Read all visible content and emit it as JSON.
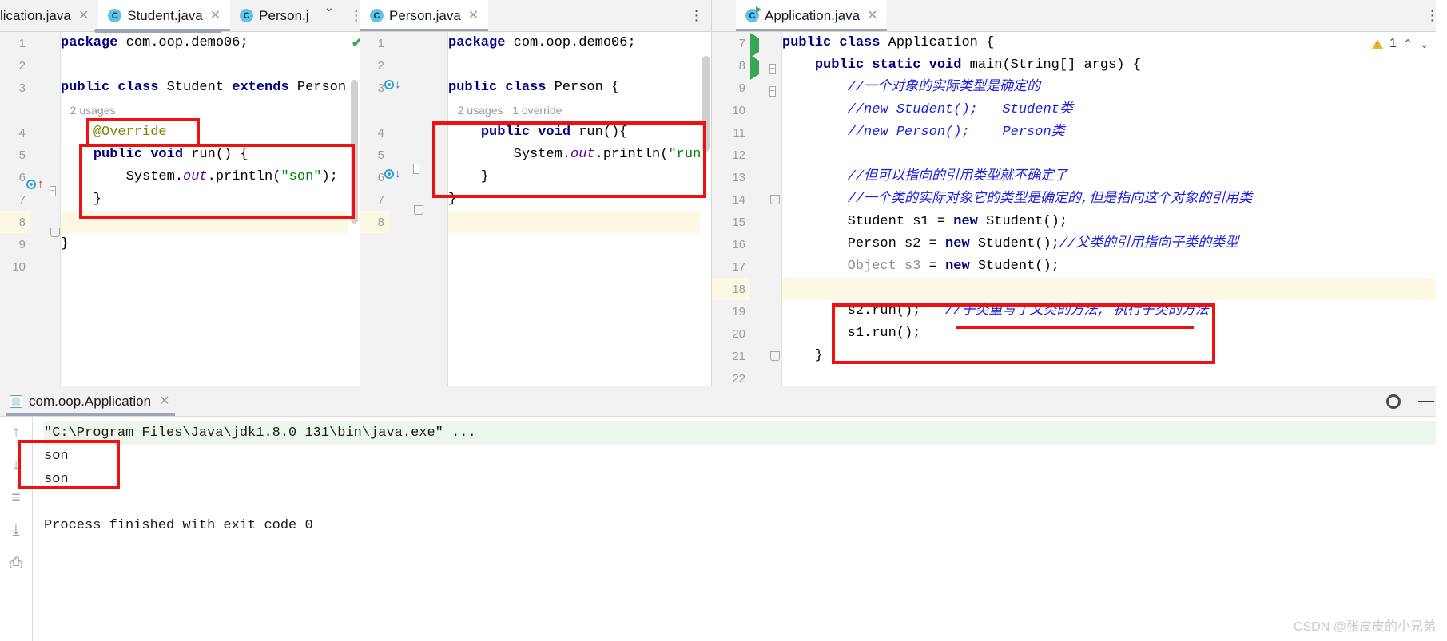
{
  "app": {
    "watermark": "CSDN @张皮皮的小兄弟"
  },
  "panes": [
    {
      "id": "left",
      "tabs": [
        {
          "label": "lication.java",
          "icon": "java-class-icon",
          "active": false,
          "truncated": true
        },
        {
          "label": "Student.java",
          "icon": "java-class-icon",
          "active": true
        },
        {
          "label": "Person.j",
          "icon": "java-class-icon",
          "active": false,
          "truncated": true
        }
      ],
      "overflow_chevron": "chevron-down-icon",
      "kebab": "⋮",
      "status_icon": "check-ok-icon",
      "first_line": 1,
      "lines": [
        {
          "n": 1,
          "html": "<span class=\"kw\">package</span> com.oop.demo06;"
        },
        {
          "n": 2,
          "html": ""
        },
        {
          "n": 3,
          "html": "<span class=\"kw\">public class</span> Student <span class=\"kw\">extends</span> Person"
        },
        {
          "n": null,
          "hint": "   2 usages"
        },
        {
          "n": 4,
          "html": "    <span class=\"ann\">@Override</span>"
        },
        {
          "n": 5,
          "html": "    <span class=\"kw\">public void</span> run() {"
        },
        {
          "n": 6,
          "html": "        System.<span class=\"fld\">out</span>.println(<span class=\"str\">\"son\"</span>);"
        },
        {
          "n": 7,
          "html": "    }"
        },
        {
          "n": 8,
          "html": "",
          "hl": true
        },
        {
          "n": 9,
          "html": "}"
        },
        {
          "n": 10,
          "html": ""
        }
      ]
    },
    {
      "id": "middle",
      "tabs": [
        {
          "label": "Person.java",
          "icon": "java-class-icon",
          "active": true
        }
      ],
      "kebab": "⋮",
      "status_icon": "check-ok-icon",
      "lines": [
        {
          "n": 1,
          "html": "<span class=\"kw\">package</span> com.oop.demo06;"
        },
        {
          "n": 2,
          "html": ""
        },
        {
          "n": 3,
          "html": "<span class=\"kw\">public class</span> Person {"
        },
        {
          "n": null,
          "hint": "   2 usages   1 override"
        },
        {
          "n": 4,
          "html": "    <span class=\"kw\">public void</span> run(){"
        },
        {
          "n": 5,
          "html": "        System.<span class=\"fld\">out</span>.println(<span class=\"str\">\"run\"</span>);"
        },
        {
          "n": 6,
          "html": "    }"
        },
        {
          "n": 7,
          "html": "}"
        },
        {
          "n": 8,
          "html": "",
          "hl": true
        }
      ]
    },
    {
      "id": "right",
      "tabs": [
        {
          "label": "Application.java",
          "icon": "java-class-run-icon",
          "active": true
        }
      ],
      "kebab": "⋮",
      "status_icon": "check-ok-icon",
      "warning_count": "1",
      "nav_up": "chevron-up-icon",
      "nav_down": "chevron-down-icon",
      "lines": [
        {
          "n": 7,
          "html": "<span class=\"kw\">public class</span> Application {",
          "run": true
        },
        {
          "n": 8,
          "html": "    <span class=\"kw\">public static void</span> main(String[] args) {",
          "run": true
        },
        {
          "n": 9,
          "html": "        <span class=\"cmt\">//一个对象的实际类型是确定的</span>"
        },
        {
          "n": 10,
          "html": "        <span class=\"cmt\">//new Student();   Student类</span>"
        },
        {
          "n": 11,
          "html": "        <span class=\"cmt\">//new Person();    Person类</span>"
        },
        {
          "n": 12,
          "html": ""
        },
        {
          "n": 13,
          "html": "        <span class=\"cmt\">//但可以指向的引用类型就不确定了</span>"
        },
        {
          "n": 14,
          "html": "        <span class=\"cmt\">//一个类的实际对象它的类型是确定的,但是指向这个对象的引用类</span>"
        },
        {
          "n": 15,
          "html": "        Student s1 = <span class=\"kw\">new</span> Student();"
        },
        {
          "n": 16,
          "html": "        Person s2 = <span class=\"kw\">new</span> Student();<span class=\"cmt\">//父类的引用指向子类的类型</span>"
        },
        {
          "n": 17,
          "html": "        <span class=\"gray\">Object s3</span> = <span class=\"kw\">new</span> Student();"
        },
        {
          "n": 18,
          "html": "",
          "hl": true
        },
        {
          "n": 19,
          "html": "        s2.run();   <span class=\"cmtu\">//子类重写了父类的方法, 执行子类的方法</span>"
        },
        {
          "n": 20,
          "html": "        s1.run();"
        },
        {
          "n": 21,
          "html": "    }"
        },
        {
          "n": 22,
          "html": ""
        }
      ]
    }
  ],
  "console": {
    "tab_label": "com.oop.Application",
    "tab_icon": "console-window-icon",
    "close_icon": "close-icon",
    "settings_icon": "gear-icon",
    "minimize_icon": "minimize-icon",
    "gutter_icons": [
      "scroll-up-icon",
      "scroll-down-icon",
      "soft-wrap-icon",
      "scroll-to-end-icon",
      "print-icon"
    ],
    "output": [
      {
        "text": "\"C:\\Program Files\\Java\\jdk1.8.0_131\\bin\\java.exe\" ...",
        "cmd": true
      },
      {
        "text": "son"
      },
      {
        "text": "son"
      },
      {
        "text": ""
      },
      {
        "text": "Process finished with exit code 0"
      }
    ]
  }
}
